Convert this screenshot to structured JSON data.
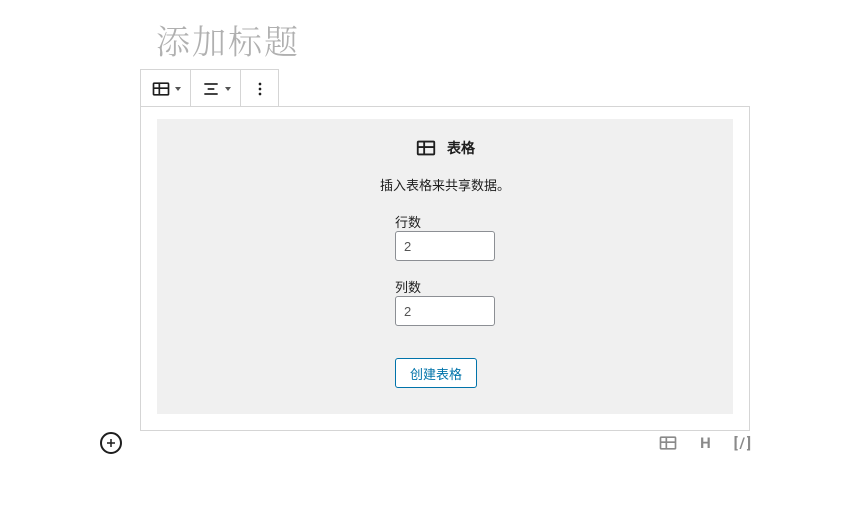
{
  "title_placeholder": "添加标题",
  "block": {
    "name": "表格",
    "description": "插入表格来共享数据。",
    "rows_label": "行数",
    "rows_value": "2",
    "cols_label": "列数",
    "cols_value": "2",
    "create_label": "创建表格"
  }
}
